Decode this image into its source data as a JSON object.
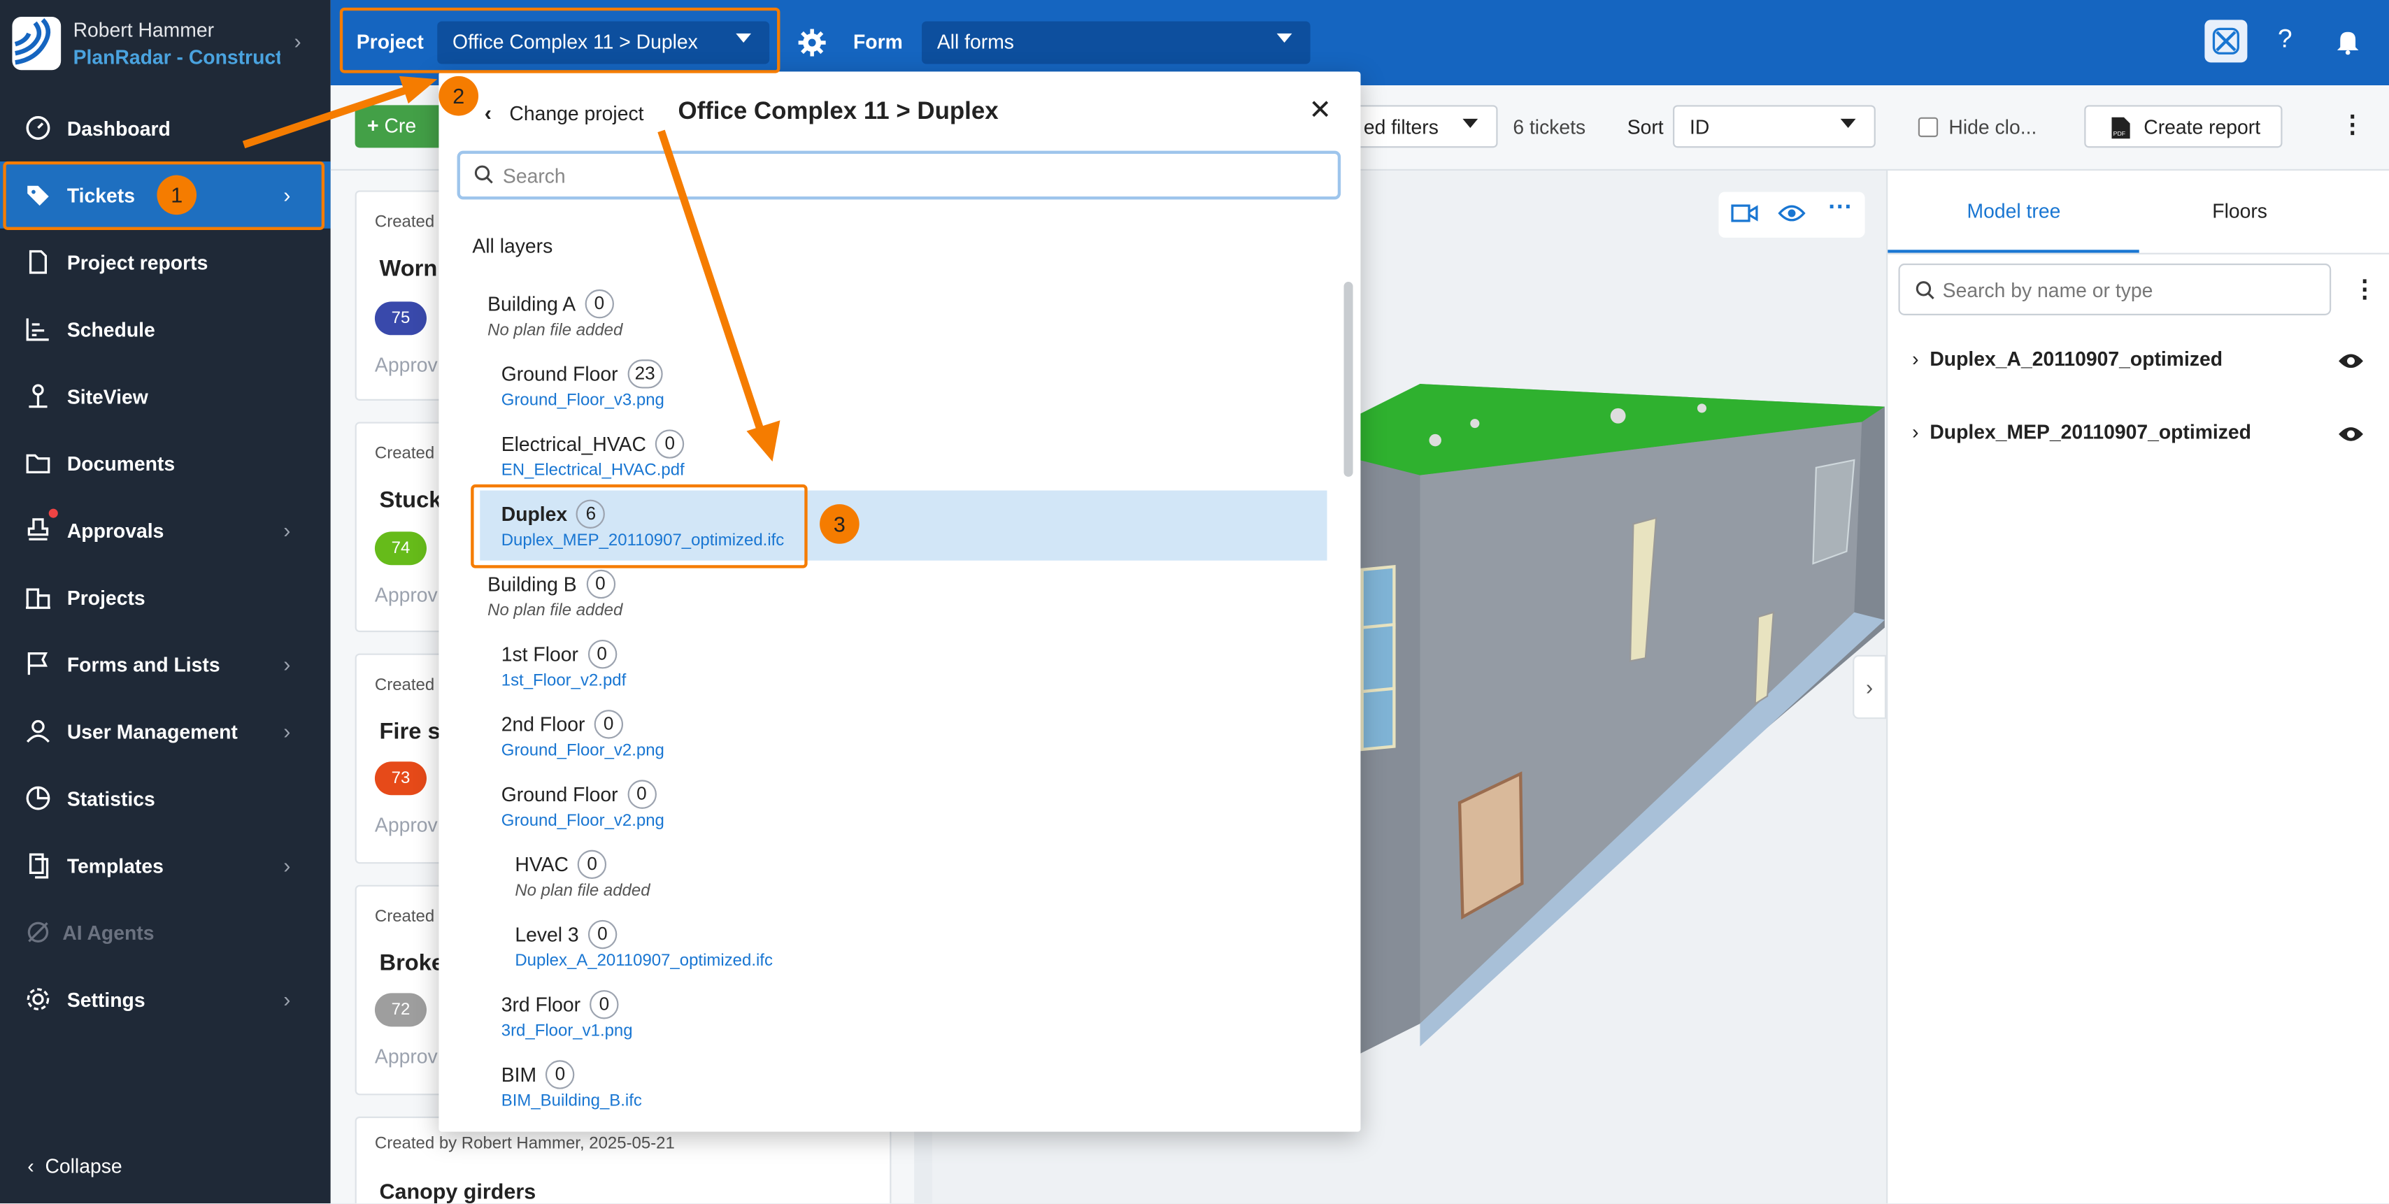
{
  "user": {
    "name": "Robert Hammer",
    "org": "PlanRadar - Construction"
  },
  "nav": [
    {
      "label": "Dashboard"
    },
    {
      "label": "Tickets"
    },
    {
      "label": "Project reports"
    },
    {
      "label": "Schedule"
    },
    {
      "label": "SiteView"
    },
    {
      "label": "Documents"
    },
    {
      "label": "Approvals"
    },
    {
      "label": "Projects"
    },
    {
      "label": "Forms and Lists"
    },
    {
      "label": "User Management"
    },
    {
      "label": "Statistics"
    },
    {
      "label": "Templates"
    },
    {
      "label": "AI Agents"
    },
    {
      "label": "Settings"
    }
  ],
  "collapse_label": "Collapse",
  "topbar": {
    "project_label": "Project",
    "project_value": "Office Complex 11 > Duplex",
    "form_label": "Form",
    "form_value": "All forms"
  },
  "toolbar": {
    "create_label": "Cre",
    "filters_label": "ed filters",
    "ticket_count": "6 tickets",
    "sort_label": "Sort",
    "sort_value": "ID",
    "hide_closed": "Hide clo...",
    "report_label": "Create report"
  },
  "cards": [
    {
      "created": "Created",
      "title": "Worn",
      "badge": "75",
      "status": "Approv"
    },
    {
      "created": "Created",
      "title": "Stuck",
      "badge": "74",
      "status": "Approv"
    },
    {
      "created": "Created",
      "title": "Fire sa",
      "badge": "73",
      "status": "Approv"
    },
    {
      "created": "Created",
      "title": "Broke",
      "badge": "72",
      "status": "Approv"
    },
    {
      "created": "Created by Robert Hammer, 2025-05-21",
      "title": "Canopy girders"
    }
  ],
  "right_panel": {
    "tab_model": "Model tree",
    "tab_floors": "Floors",
    "search_placeholder": "Search by name or type",
    "items": [
      "Duplex_A_20110907_optimized",
      "Duplex_MEP_20110907_optimized"
    ]
  },
  "dropdown": {
    "back_label": "Change project",
    "title": "Office Complex 11 > Duplex",
    "search_placeholder": "Search",
    "all_layers": "All layers",
    "layers": [
      {
        "name": "Building A",
        "count": "0",
        "file": "No plan file added"
      },
      {
        "name": "Ground Floor",
        "count": "23",
        "file": "Ground_Floor_v3.png"
      },
      {
        "name": "Electrical_HVAC",
        "count": "0",
        "file": "EN_Electrical_HVAC.pdf"
      },
      {
        "name": "Duplex",
        "count": "6",
        "file": "Duplex_MEP_20110907_optimized.ifc"
      },
      {
        "name": "Building B",
        "count": "0",
        "file": "No plan file added"
      },
      {
        "name": "1st Floor",
        "count": "0",
        "file": "1st_Floor_v2.pdf"
      },
      {
        "name": "2nd Floor",
        "count": "0",
        "file": "Ground_Floor_v2.png"
      },
      {
        "name": "Ground Floor",
        "count": "0",
        "file": "Ground_Floor_v2.png"
      },
      {
        "name": "HVAC",
        "count": "0",
        "file": "No plan file added"
      },
      {
        "name": "Level 3",
        "count": "0",
        "file": "Duplex_A_20110907_optimized.ifc"
      },
      {
        "name": "3rd Floor",
        "count": "0",
        "file": "3rd_Floor_v1.png"
      },
      {
        "name": "BIM",
        "count": "0",
        "file": "BIM_Building_B.ifc"
      }
    ]
  },
  "annotations": [
    "1",
    "2",
    "3"
  ],
  "colors": {
    "accent": "#1565c0",
    "highlight": "#f57c00",
    "sidebar": "#1f2937"
  }
}
